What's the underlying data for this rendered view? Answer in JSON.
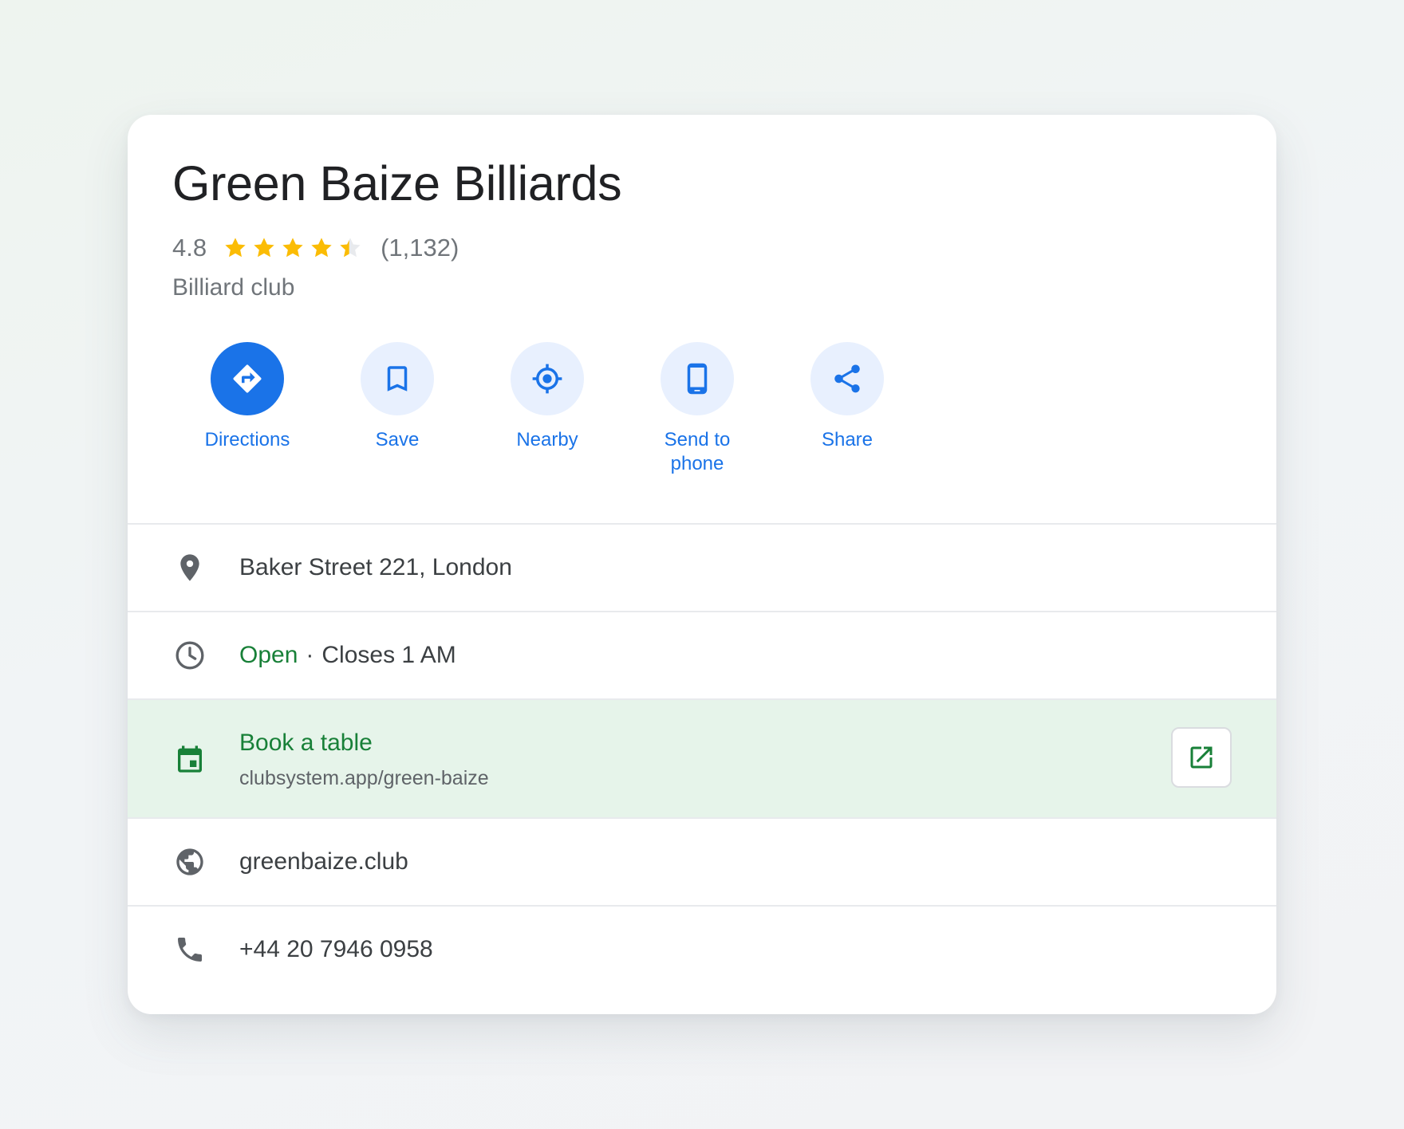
{
  "place": {
    "name": "Green Baize Billiards",
    "rating": "4.8",
    "rating_fraction": 0.96,
    "stars": [
      "full",
      "full",
      "full",
      "full",
      "partial"
    ],
    "review_count": "(1,132)",
    "category": "Billiard club"
  },
  "actions": [
    {
      "label": "Directions",
      "icon": "directions-icon"
    },
    {
      "label": "Save",
      "icon": "bookmark-icon"
    },
    {
      "label": "Nearby",
      "icon": "nearby-icon"
    },
    {
      "label": "Send to\nphone",
      "icon": "phone-device-icon"
    },
    {
      "label": "Share",
      "icon": "share-icon"
    }
  ],
  "details": {
    "address": "Baker Street 221, London",
    "hours_status": "Open",
    "hours_separator": "·",
    "hours_detail": "Closes 1 AM",
    "booking_title": "Book a table",
    "booking_url": "clubsystem.app/green-baize",
    "website": "greenbaize.club",
    "phone": "+44 20 7946 0958"
  },
  "colors": {
    "accent_blue": "#1a73e8",
    "action_bg": "#e8f0fe",
    "open_green": "#188038",
    "booking_bg": "#e6f4ea",
    "star_yellow": "#fbbc04",
    "muted_text": "#70757a"
  }
}
